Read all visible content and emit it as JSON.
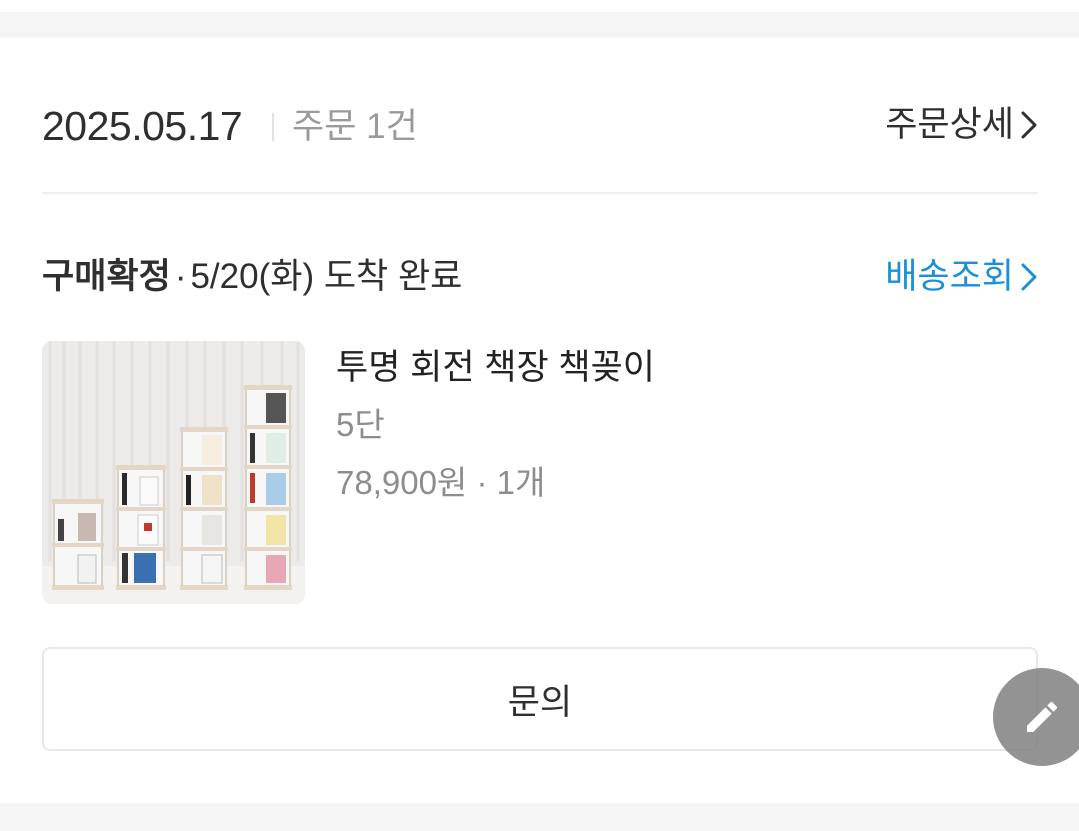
{
  "order": {
    "date": "2025.05.17",
    "count_label": "주문 1건",
    "detail_label": "주문상세"
  },
  "delivery": {
    "status": "구매확정",
    "separator": "·",
    "arrival": "5/20(화) 도착 완료",
    "tracking_label": "배송조회",
    "tracking_color": "#1a90d9"
  },
  "product": {
    "name": "투명 회전 책장 책꽂이",
    "option": "5단",
    "price": "78,900원 · 1개",
    "image_icon": "rotating-bookshelf-photo"
  },
  "actions": {
    "inquiry_label": "문의",
    "floating_icon": "pencil-icon"
  }
}
